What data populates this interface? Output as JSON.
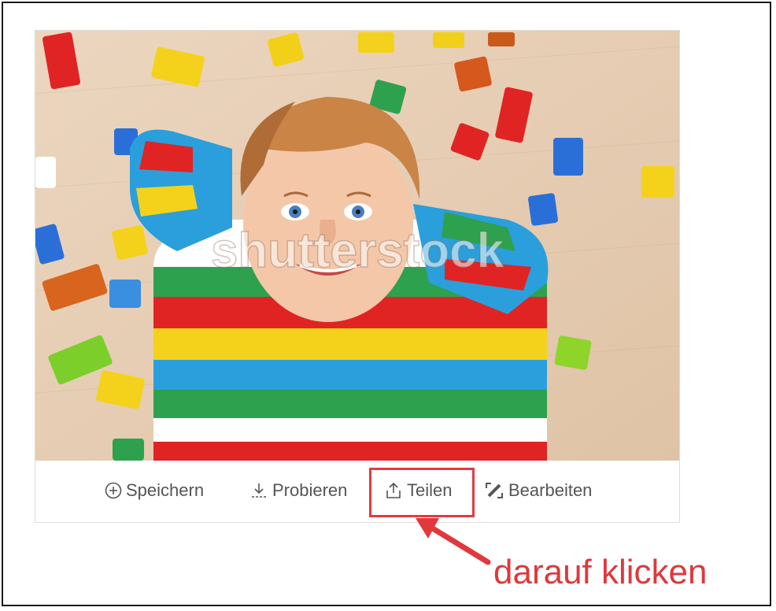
{
  "photo": {
    "watermark": "shutterstock",
    "alt_icon": "photo-boy-lego"
  },
  "toolbar": {
    "save_label": "Speichern",
    "try_label": "Probieren",
    "share_label": "Teilen",
    "edit_label": "Bearbeiten",
    "icons": {
      "save": "plus-circle-icon",
      "try": "download-icon",
      "share": "share-icon",
      "edit": "edit-wand-icon"
    }
  },
  "annotation": {
    "text": "darauf klicken",
    "color": "#e0383d"
  },
  "colors": {
    "highlight": "#e33b3f",
    "text": "#555555",
    "frame": "#1a1a1a",
    "floor": "#e6cdb3"
  }
}
